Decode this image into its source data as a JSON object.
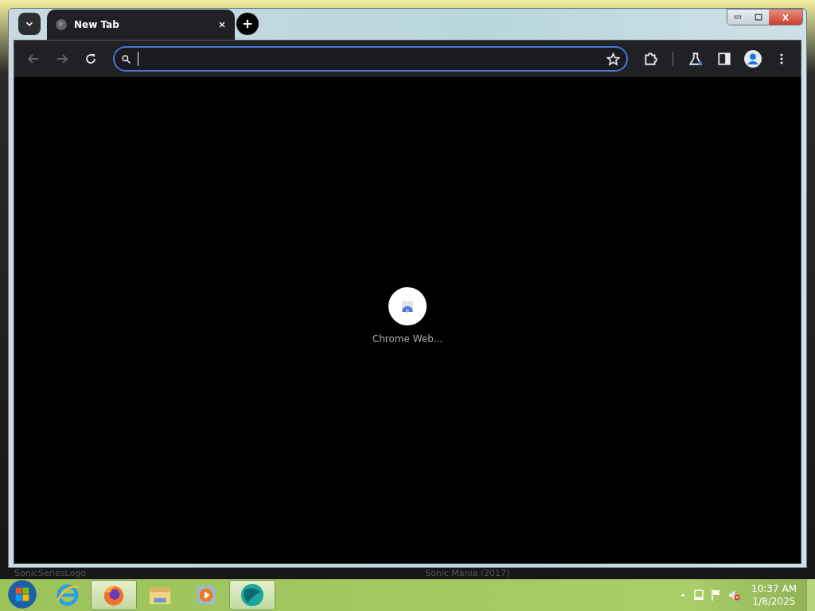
{
  "browser": {
    "tabs": [
      {
        "title": "New Tab",
        "selected": true
      }
    ],
    "toolbar": {
      "back_disabled": true,
      "forward_disabled": true,
      "address_focused": true
    },
    "shortcuts": [
      {
        "label": "Chrome Web..."
      }
    ]
  },
  "desktop_labels": [
    "SonicSeriesLogo",
    "Sonic Mania (2017)"
  ],
  "taskbar": {
    "apps": [
      {
        "kind": "ie",
        "selected": false
      },
      {
        "kind": "firefox",
        "selected": true
      },
      {
        "kind": "explorer",
        "selected": false
      },
      {
        "kind": "media",
        "selected": false
      },
      {
        "kind": "globe",
        "selected": true
      }
    ],
    "clock": {
      "time": "10:37 AM",
      "date": "1/8/2025"
    }
  }
}
